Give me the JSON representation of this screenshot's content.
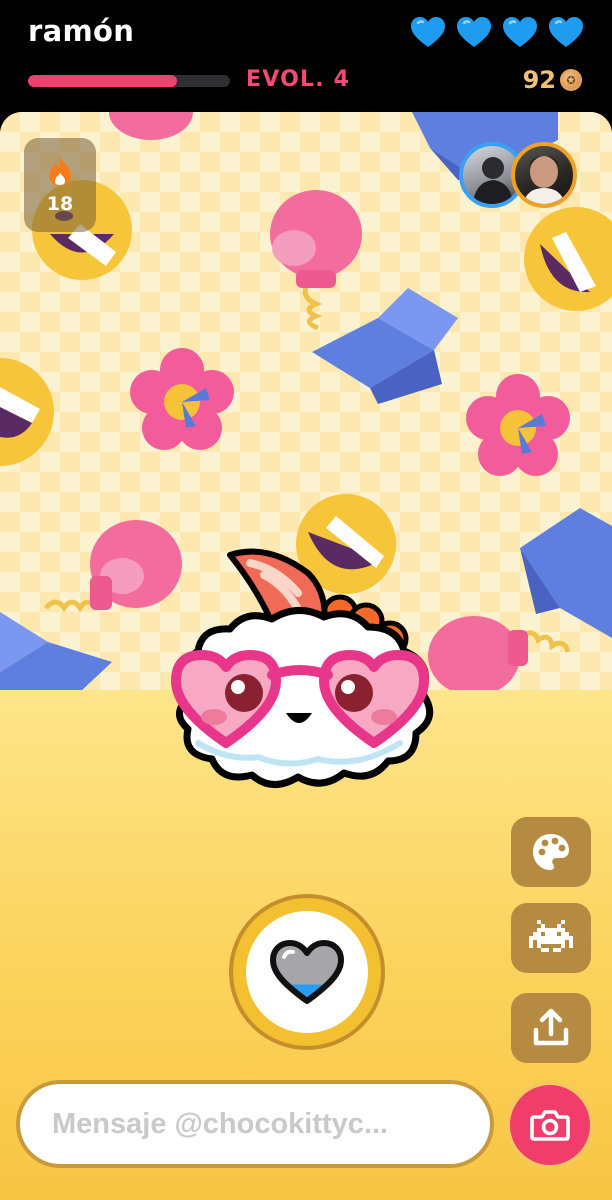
{
  "header": {
    "username": "ramón",
    "hearts": [
      {
        "icon": "heart-icon",
        "color": "#1f9bf0"
      },
      {
        "icon": "heart-icon",
        "color": "#1f9bf0"
      },
      {
        "icon": "heart-icon",
        "color": "#1f9bf0"
      },
      {
        "icon": "heart-icon",
        "color": "#1f9bf0"
      }
    ],
    "evolution_label": "EVOL. 4",
    "evolution_progress": 0.74,
    "coins": "92",
    "accent_color": "#f0416e"
  },
  "stage": {
    "streak": {
      "icon": "flame-icon",
      "count": "18"
    },
    "friends": [
      {
        "icon": "friend-avatar",
        "ring_color": "#3aa0f2"
      },
      {
        "icon": "friend-avatar",
        "ring_color": "#f0a226"
      }
    ],
    "pet": {
      "icon": "sushi-pet-with-heart-glasses"
    },
    "side_actions": [
      {
        "icon": "palette-icon"
      },
      {
        "icon": "space-invader-icon"
      },
      {
        "icon": "share-icon"
      }
    ],
    "heart_button": {
      "icon": "heart-meter-icon",
      "fill_level": 0.25
    }
  },
  "composer": {
    "placeholder": "Mensaje @chocokittyc...",
    "camera_icon": "camera-icon"
  }
}
